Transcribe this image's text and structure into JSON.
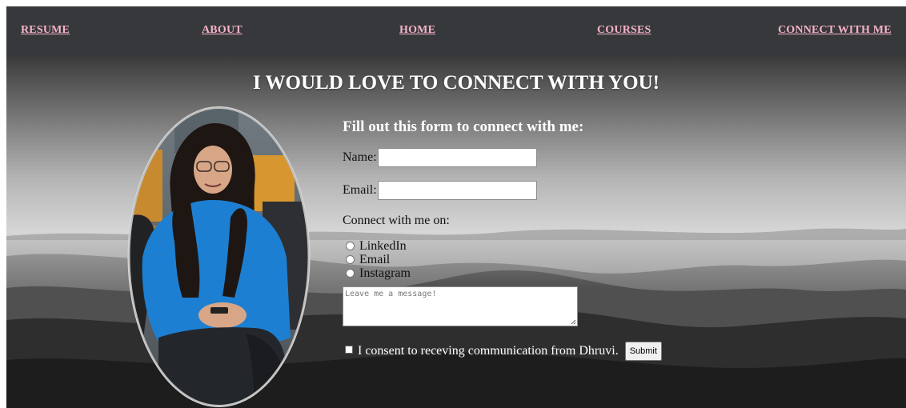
{
  "nav": {
    "items": [
      {
        "label": "RESUME"
      },
      {
        "label": "ABOUT"
      },
      {
        "label": "HOME"
      },
      {
        "label": "COURSES"
      },
      {
        "label": "CONNECT WITH ME"
      }
    ]
  },
  "hero": {
    "title": "I WOULD LOVE TO CONNECT WITH YOU!"
  },
  "form": {
    "heading": "Fill out this form to connect with me:",
    "name_label": "Name:",
    "name_value": "",
    "email_label": "Email:",
    "email_value": "",
    "connect_label": "Connect with me on:",
    "options": [
      {
        "label": "LinkedIn"
      },
      {
        "label": "Email"
      },
      {
        "label": "Instagram"
      }
    ],
    "message_placeholder": "Leave me a message!",
    "consent_label": "I consent to receving communication from Dhruvi.",
    "submit_label": "Submit"
  },
  "colors": {
    "nav_bg": "#36383b",
    "nav_link": "#f7b3c8",
    "title_text": "#ffffff"
  },
  "icons": {
    "portrait": "profile-photo",
    "background": "misty-mountains-image"
  }
}
